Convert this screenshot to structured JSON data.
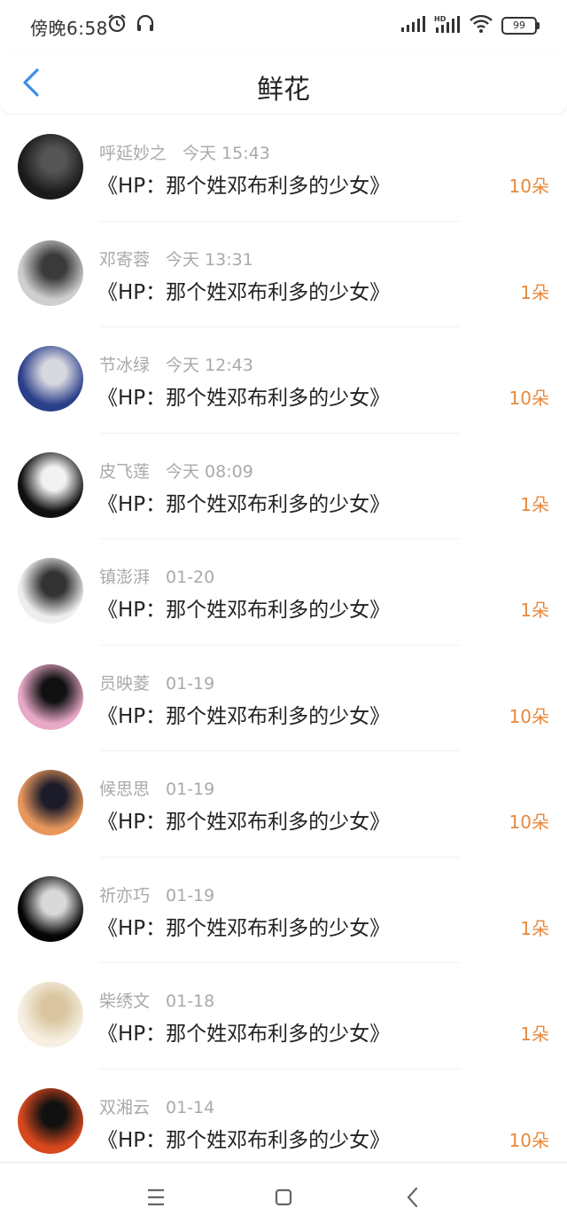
{
  "status": {
    "time": "傍晚6:58",
    "battery": "99",
    "icons": [
      "alarm-icon",
      "headset-icon",
      "signal-icon",
      "hd-signal-icon",
      "wifi-icon",
      "battery-icon"
    ]
  },
  "header": {
    "title": "鲜花",
    "back_icon": "chevron-left-icon",
    "accent": "#3b8fe8"
  },
  "colors": {
    "amount": "#e8883a",
    "meta": "#a9a9a9"
  },
  "items": [
    {
      "name": "呼延妙之",
      "time": "今天 15:43",
      "book": "《HP：那个姓邓布利多的少女》",
      "amount": "10朵",
      "avatar_colors": [
        "#1a1a1a",
        "#555555"
      ]
    },
    {
      "name": "邓寄蓉",
      "time": "今天 13:31",
      "book": "《HP：那个姓邓布利多的少女》",
      "amount": "1朵",
      "avatar_colors": [
        "#cfcfcf",
        "#3a3a3a"
      ]
    },
    {
      "name": "节冰绿",
      "time": "今天 12:43",
      "book": "《HP：那个姓邓布利多的少女》",
      "amount": "10朵",
      "avatar_colors": [
        "#2a3f8a",
        "#d8d8e0"
      ]
    },
    {
      "name": "皮飞莲",
      "time": "今天 08:09",
      "book": "《HP：那个姓邓布利多的少女》",
      "amount": "1朵",
      "avatar_colors": [
        "#101010",
        "#f2f2f2"
      ]
    },
    {
      "name": "镇澎湃",
      "time": "01-20",
      "book": "《HP：那个姓邓布利多的少女》",
      "amount": "1朵",
      "avatar_colors": [
        "#eeeeee",
        "#333333"
      ]
    },
    {
      "name": "员映菱",
      "time": "01-19",
      "book": "《HP：那个姓邓布利多的少女》",
      "amount": "10朵",
      "avatar_colors": [
        "#e8a8c8",
        "#111111"
      ]
    },
    {
      "name": "候思思",
      "time": "01-19",
      "book": "《HP：那个姓邓布利多的少女》",
      "amount": "10朵",
      "avatar_colors": [
        "#e8975c",
        "#1b1b2a"
      ]
    },
    {
      "name": "祈亦巧",
      "time": "01-19",
      "book": "《HP：那个姓邓布利多的少女》",
      "amount": "1朵",
      "avatar_colors": [
        "#050505",
        "#d9d9d9"
      ]
    },
    {
      "name": "柴绣文",
      "time": "01-18",
      "book": "《HP：那个姓邓布利多的少女》",
      "amount": "1朵",
      "avatar_colors": [
        "#f6efe2",
        "#d9c6a0"
      ]
    },
    {
      "name": "双湘云",
      "time": "01-14",
      "book": "《HP：那个姓邓布利多的少女》",
      "amount": "10朵",
      "avatar_colors": [
        "#d8481e",
        "#111111"
      ]
    }
  ],
  "nav": {
    "icons": [
      "menu-icon",
      "home-square-icon",
      "back-triangle-icon"
    ]
  }
}
